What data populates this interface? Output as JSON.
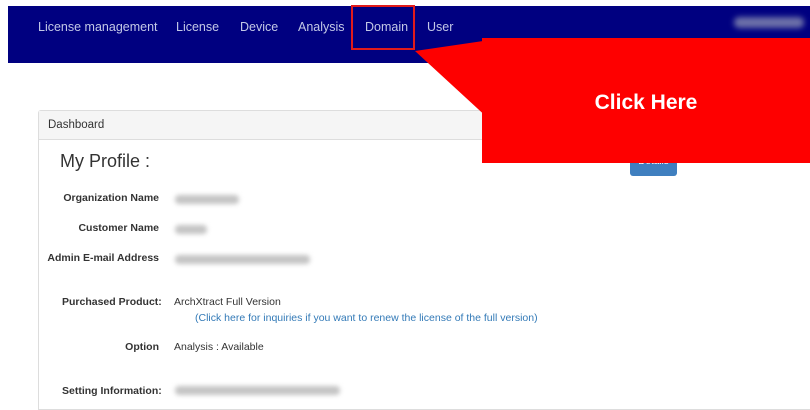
{
  "nav": {
    "items": [
      {
        "label": "License management"
      },
      {
        "label": "License"
      },
      {
        "label": "Device"
      },
      {
        "label": "Analysis"
      },
      {
        "label": "Domain"
      },
      {
        "label": "User"
      }
    ],
    "highlighted": "Domain"
  },
  "panel": {
    "heading": "Dashboard",
    "title": "My Profile :",
    "details_button": "Details"
  },
  "profile": {
    "organization_label": "Organization Name",
    "customer_label": "Customer Name",
    "admin_email_label": "Admin E-mail Address",
    "purchased_label": "Purchased Product:",
    "purchased_value": "ArchXtract Full Version",
    "renew_link": "(Click here for inquiries if you want to renew the license of the full version)",
    "option_label": "Option",
    "option_value": "Analysis : Available",
    "setting_label": "Setting Information:"
  },
  "callout": {
    "text": "Click Here",
    "color": "#fe0000"
  },
  "colors": {
    "navbar": "#000080",
    "link": "#337ab7",
    "button": "#3f7fbf"
  }
}
